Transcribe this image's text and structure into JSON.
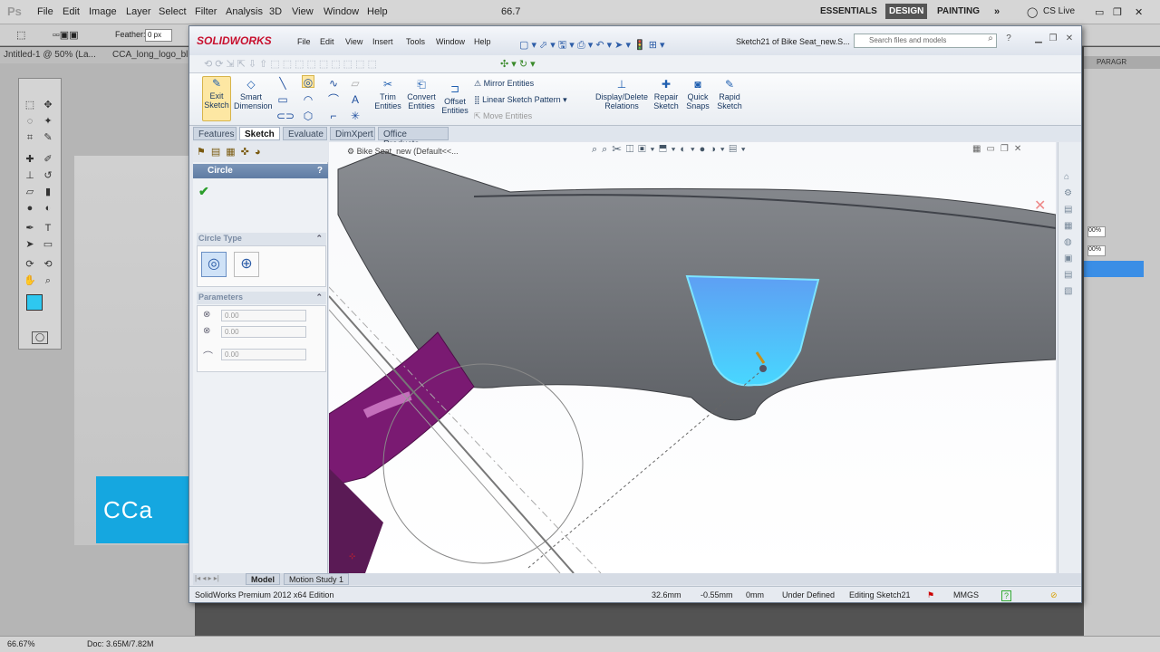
{
  "photoshop": {
    "logo": "Ps",
    "menu": [
      "File",
      "Edit",
      "Image",
      "Layer",
      "Select",
      "Filter",
      "Analysis",
      "3D",
      "View",
      "Window",
      "Help"
    ],
    "zoom": "66.7",
    "workspaces": [
      "ESSENTIALS",
      "DESIGN",
      "PAINTING"
    ],
    "cs_live": "CS Live",
    "feather_label": "Feather:",
    "feather_value": "0 px",
    "doc_tabs": [
      "Jntitled-1 @ 50% (La...",
      "CCA_long_logo_bl..."
    ],
    "status_zoom": "66.67%",
    "status_doc": "Doc: 3.65M/7.82M",
    "panel_tab": "PARAGR",
    "panel_fields": [
      "00%",
      "00%"
    ],
    "logo_text": "CCa",
    "fg_color": "#2ec8f0"
  },
  "solidworks": {
    "brand": "SOLIDWORKS",
    "menu": [
      "File",
      "Edit",
      "View",
      "Insert",
      "Tools",
      "Window",
      "Help"
    ],
    "doc_title": "Sketch21 of Bike Seat_new.S...",
    "search_placeholder": "Search files and models",
    "commands": {
      "exit_sketch": "Exit Sketch",
      "smart_dimension": "Smart Dimension",
      "trim": "Trim Entities",
      "convert": "Convert Entities",
      "offset": "Offset Entities",
      "mirror": "Mirror Entities",
      "linear_pattern": "Linear Sketch Pattern",
      "move": "Move Entities",
      "relations": "Display/Delete Relations",
      "repair": "Repair Sketch",
      "quick_snaps": "Quick Snaps",
      "rapid": "Rapid Sketch"
    },
    "tabs": [
      "Features",
      "Sketch",
      "Evaluate",
      "DimXpert",
      "Office Products"
    ],
    "active_tab": "Sketch",
    "property_manager": {
      "title": "Circle",
      "help": "?",
      "circle_type_header": "Circle Type",
      "parameters_header": "Parameters",
      "param_x": "0.00",
      "param_y": "0.00",
      "param_r": "0.00"
    },
    "tree_label": "Bike Seat_new (Default<<...",
    "bottom_tabs": [
      "Model",
      "Motion Study 1"
    ],
    "status": {
      "edition": "SolidWorks Premium 2012 x64 Edition",
      "x": "32.6mm",
      "y": "-0.55mm",
      "z": "0mm",
      "state": "Under Defined",
      "editing": "Editing Sketch21",
      "units": "MMGS"
    },
    "highlight_color": "#35c6f4",
    "part_color": "#7a1a72"
  }
}
